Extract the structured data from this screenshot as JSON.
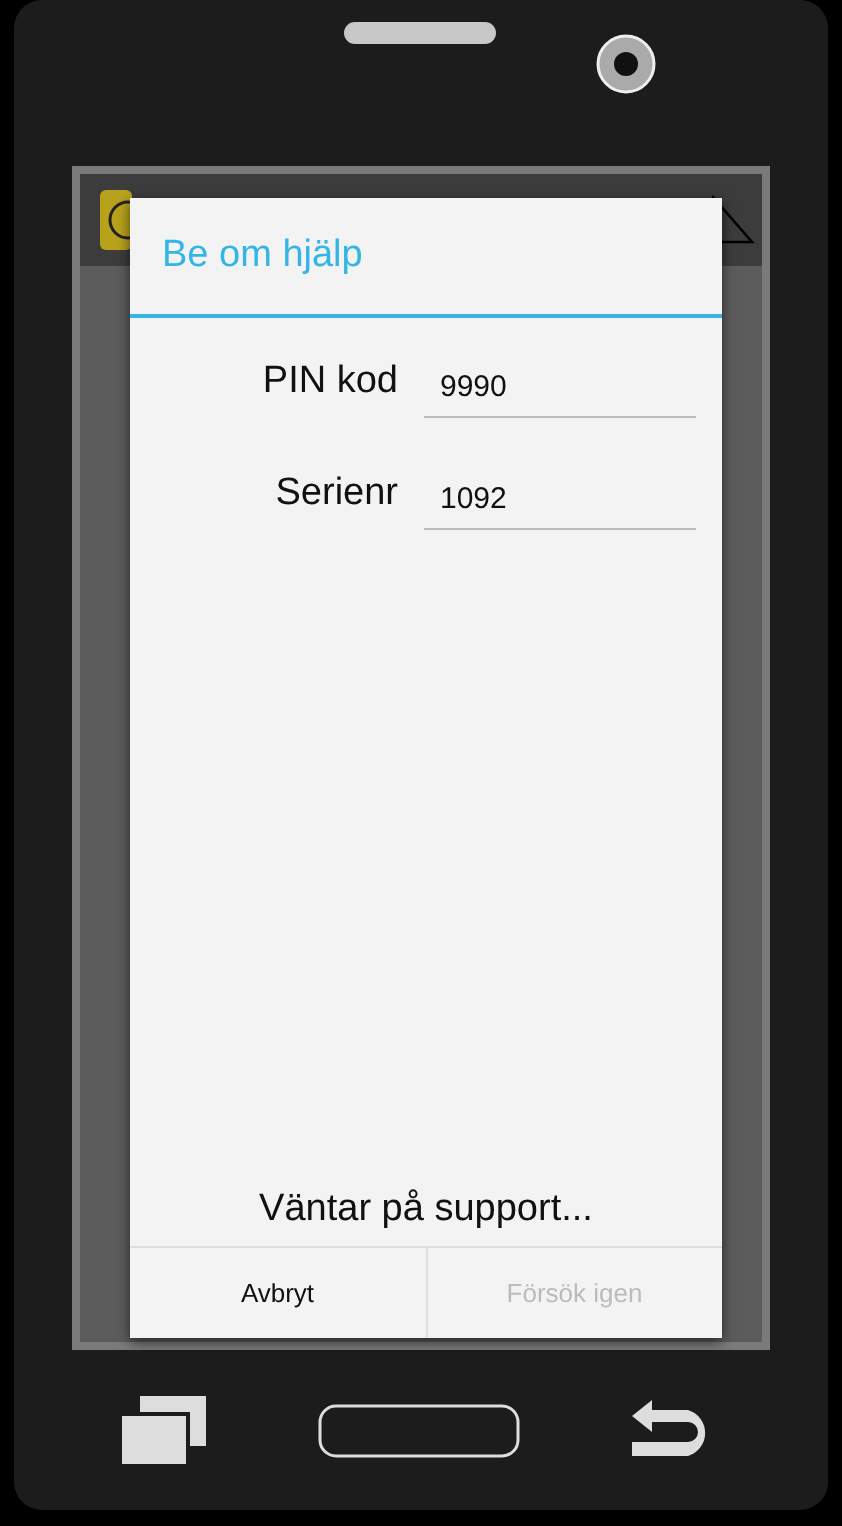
{
  "dialog": {
    "title": "Be om hjälp",
    "fields": [
      {
        "label": "PIN kod",
        "value": "9990"
      },
      {
        "label": "Serienr",
        "value": "1092"
      }
    ],
    "status": "Väntar på support...",
    "buttons": [
      {
        "label": "Avbryt",
        "disabled": false
      },
      {
        "label": "Försök igen",
        "disabled": true
      }
    ]
  }
}
